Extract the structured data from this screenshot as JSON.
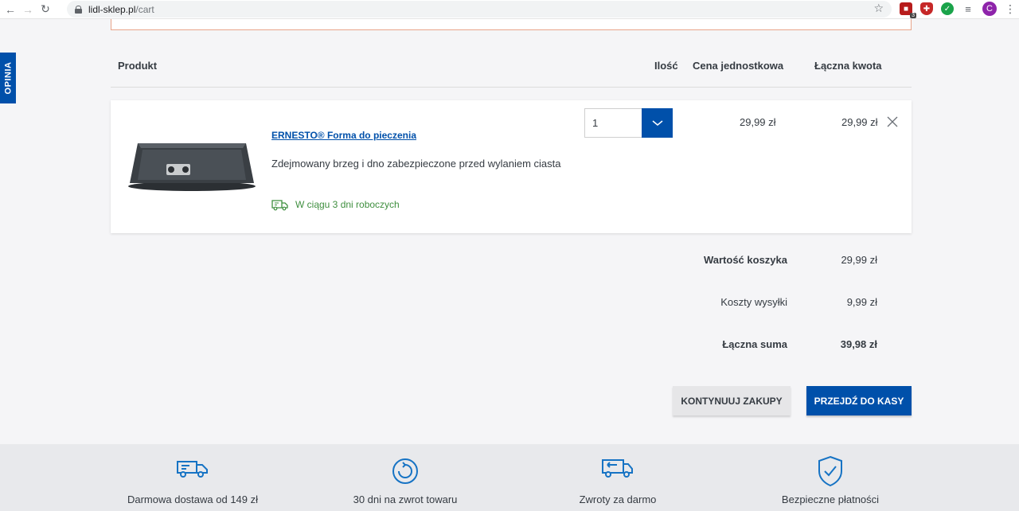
{
  "browser": {
    "url_host": "lidl-sklep.pl",
    "url_path": "/cart",
    "extension_badge": "3",
    "avatar_letter": "C"
  },
  "feedback_tab": {
    "label": "OPINIA"
  },
  "cart_table": {
    "headers": {
      "product": "Produkt",
      "quantity": "Ilość",
      "unit_price": "Cena jednostkowa",
      "total": "Łączna kwota"
    }
  },
  "cart_item": {
    "name": "ERNESTO® Forma do pieczenia",
    "description": "Zdejmowany brzeg i dno zabezpieczone przed wylaniem ciasta",
    "delivery": "W ciągu 3 dni roboczych",
    "quantity": "1",
    "unit_price": "29,99 zł",
    "line_total": "29,99 zł"
  },
  "summary": {
    "subtotal_label": "Wartość koszyka",
    "subtotal_value": "29,99 zł",
    "shipping_label": "Koszty wysyłki",
    "shipping_value": "9,99 zł",
    "total_label": "Łączna suma",
    "total_value": "39,98 zł"
  },
  "actions": {
    "continue_label": "KONTYNUUJ ZAKUPY",
    "checkout_label": "PRZEJDŹ DO KASY"
  },
  "benefits": [
    {
      "icon": "delivery-truck-icon",
      "label": "Darmowa dostawa od 149 zł"
    },
    {
      "icon": "return-cycle-icon",
      "label": "30 dni na zwrot towaru"
    },
    {
      "icon": "return-truck-icon",
      "label": "Zwroty za darmo"
    },
    {
      "icon": "shield-check-icon",
      "label": "Bezpieczne płatności"
    }
  ],
  "colors": {
    "brand_blue": "#0050aa",
    "delivery_green": "#3f8f3f",
    "benefit_icon": "#1673c4"
  }
}
